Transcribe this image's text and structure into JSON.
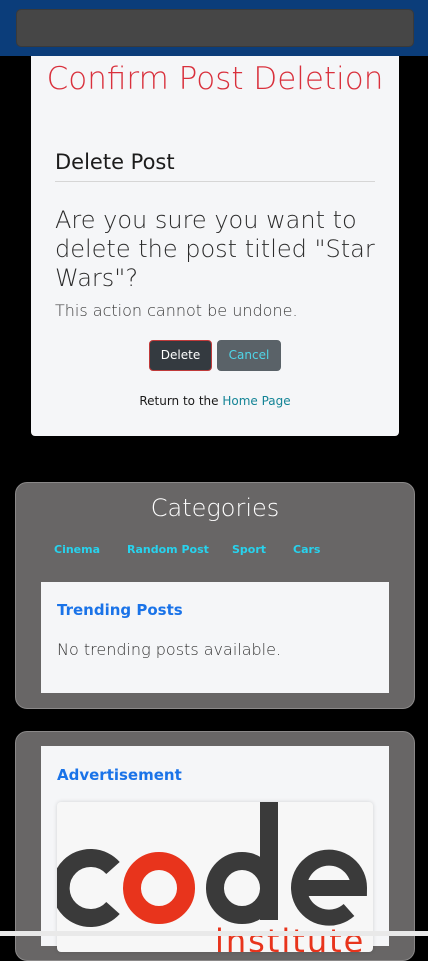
{
  "page": {
    "title": "Confirm Post Deletion",
    "section_heading": "Delete Post",
    "question": "Are you sure you want to delete the post titled \"Star Wars\"?",
    "warning": "This action cannot be undone.",
    "delete_label": "Delete",
    "cancel_label": "Cancel",
    "return_prefix": "Return to the",
    "home_link": "Home Page"
  },
  "categories": {
    "title": "Categories",
    "items": [
      "Cinema",
      "Random Post",
      "Sport",
      "Cars"
    ]
  },
  "trending": {
    "title": "Trending Posts",
    "empty_message": "No trending posts available."
  },
  "advertisement": {
    "title": "Advertisement",
    "logo_text": "code institute"
  },
  "colors": {
    "accent_red": "#d9303c",
    "link_cyan": "#27d3ee",
    "heading_blue": "#1a73e8",
    "logo_dark": "#3a3a3a",
    "logo_red": "#e8341c"
  }
}
